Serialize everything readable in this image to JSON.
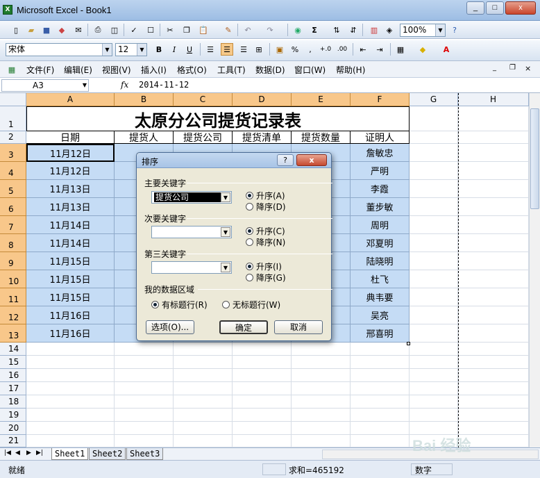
{
  "window": {
    "title": "Microsoft Excel - Book1",
    "min": "_",
    "max": "□",
    "close": "x"
  },
  "toolbar1": {
    "zoom": "100%"
  },
  "toolbar2": {
    "font": "宋体",
    "size": "12",
    "bold": "B",
    "italic": "I",
    "underline": "U",
    "percent": "%",
    "comma": ",",
    "font_color_letter": "A"
  },
  "menu": [
    "文件(F)",
    "编辑(E)",
    "视图(V)",
    "插入(I)",
    "格式(O)",
    "工具(T)",
    "数据(D)",
    "窗口(W)",
    "帮助(H)"
  ],
  "formula_bar": {
    "name_box": "A3",
    "fx": "fx",
    "value": "2014-11-12"
  },
  "columns": [
    "A",
    "B",
    "C",
    "D",
    "E",
    "F",
    "G",
    "H"
  ],
  "rows": [
    "1",
    "2",
    "3",
    "4",
    "5",
    "6",
    "7",
    "8",
    "9",
    "10",
    "11",
    "12",
    "13",
    "14",
    "15",
    "16",
    "17",
    "18",
    "19",
    "20",
    "21"
  ],
  "sheet": {
    "title": "太原分公司提货记录表",
    "headers": [
      "日期",
      "提货人",
      "提货公司",
      "提货清单",
      "提货数量",
      "证明人"
    ],
    "dates": [
      "11月12日",
      "11月12日",
      "11月13日",
      "11月13日",
      "11月14日",
      "11月14日",
      "11月15日",
      "11月15日",
      "11月15日",
      "11月16日",
      "11月16日"
    ],
    "witnesses": [
      "詹敏忠",
      "严明",
      "李霞",
      "董步敏",
      "周明",
      "邓夏明",
      "陆晓明",
      "杜飞",
      "典韦要",
      "吴亮",
      "邢喜明"
    ]
  },
  "dialog": {
    "title": "排序",
    "help": "?",
    "close": "x",
    "primary_key_label": "主要关键字",
    "primary_key_value": "提货公司",
    "secondary_key_label": "次要关键字",
    "tertiary_key_label": "第三关键字",
    "asc1": "升序(A)",
    "desc1": "降序(D)",
    "asc2": "升序(C)",
    "desc2": "降序(N)",
    "asc3": "升序(I)",
    "desc3": "降序(G)",
    "range_label": "我的数据区域",
    "has_header": "有标题行(R)",
    "no_header": "无标题行(W)",
    "options": "选项(O)...",
    "ok": "确定",
    "cancel": "取消"
  },
  "tabs": [
    "Sheet1",
    "Sheet2",
    "Sheet3"
  ],
  "status": {
    "ready": "就绪",
    "sum": "求和=465192",
    "mode": "数字"
  },
  "watermark": "Bai 经验"
}
